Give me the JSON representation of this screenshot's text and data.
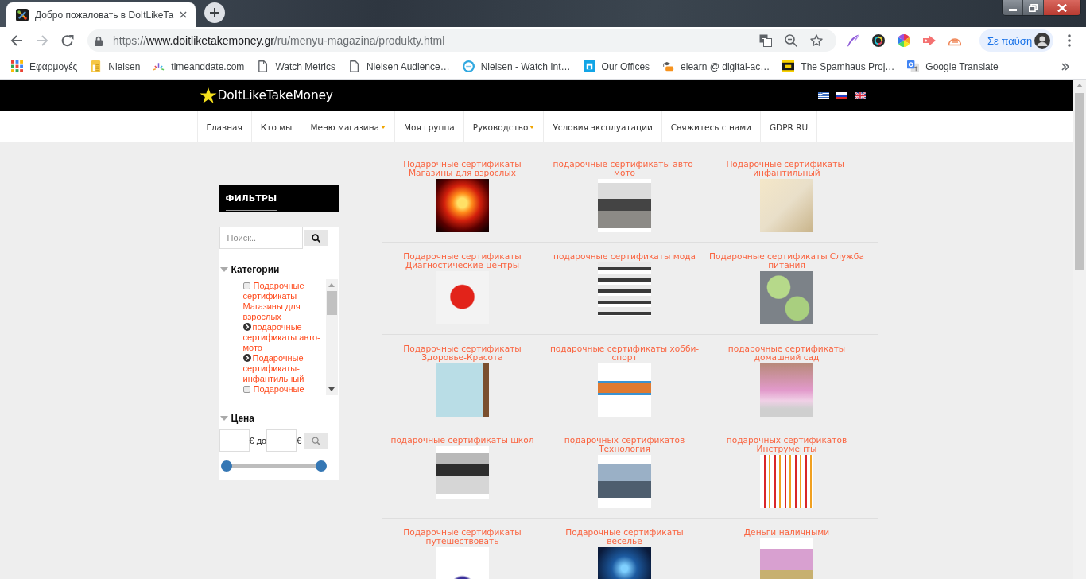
{
  "browser": {
    "tabs": [
      {
        "title": "Добро пожаловать в DoItLikeTa",
        "selected": true
      }
    ],
    "nav_buttons": [
      {
        "kind": "back",
        "disabled": false
      },
      {
        "kind": "forward",
        "disabled": true
      },
      {
        "kind": "reload",
        "disabled": false
      }
    ],
    "address": {
      "scheme": "https://",
      "host": "www.doitliketakemoney.gr",
      "path": "/ru/menyu-magazina/produkty.html"
    },
    "profile": {
      "label": "Σε παύση"
    },
    "bookmarks": [
      {
        "label": "Εφαρμογές"
      },
      {
        "label": "Nielsen"
      },
      {
        "label": "timeanddate.com"
      },
      {
        "label": "Watch Metrics"
      },
      {
        "label": "Nielsen Audience…"
      },
      {
        "label": "Nielsen - Watch Int…"
      },
      {
        "label": "Our Offices"
      },
      {
        "label": "elearn @ digital-ac…"
      },
      {
        "label": "The Spamhaus Proj…"
      },
      {
        "label": "Google Translate"
      }
    ]
  },
  "site": {
    "logo": "DoItLikeTakeMoney",
    "menu": [
      {
        "label": "Главная",
        "dropdown": false
      },
      {
        "label": "Кто мы",
        "dropdown": false
      },
      {
        "label": "Меню магазина",
        "dropdown": true
      },
      {
        "label": "Моя группа",
        "dropdown": false
      },
      {
        "label": "Руководство",
        "dropdown": true
      },
      {
        "label": "Условия эксплуатации",
        "dropdown": false
      },
      {
        "label": "Свяжитесь с нами",
        "dropdown": false
      },
      {
        "label": "GDPR RU",
        "dropdown": false
      }
    ]
  },
  "filters": {
    "title": "ФИЛЬТРЫ",
    "search": {
      "placeholder": "Поиск.."
    },
    "categories": {
      "title": "Категории",
      "expanded": true,
      "items": [
        {
          "kind": "checkbox",
          "label": "Подарочные сертификаты Магазины для взрослых",
          "checked": false
        },
        {
          "kind": "parent",
          "label": "подарочные сертификаты авто-мото",
          "expanded": false
        },
        {
          "kind": "parent",
          "label": "Подарочные сертификаты-инфантильный",
          "expanded": false
        },
        {
          "kind": "checkbox",
          "label": "Подарочные",
          "checked": false
        }
      ]
    },
    "price": {
      "title": "Цена",
      "expanded": true,
      "min_suffix": "€ до",
      "max_suffix": "€",
      "handles": [
        {
          "level": 0
        },
        {
          "level": 1
        }
      ]
    }
  },
  "products": {
    "rows": [
      {
        "divider_below": true,
        "items": [
          {
            "title": "Подарочные сертификаты Магазины для взрослых"
          },
          {
            "title": "подарочные сертификаты авто-мото"
          },
          {
            "title": "Подарочные сертификаты-инфантильный"
          }
        ]
      },
      {
        "divider_below": true,
        "items": [
          {
            "title": "Подарочные сертификаты Диагностические центры"
          },
          {
            "title": "подарочные сертификаты мода"
          },
          {
            "title": "Подарочные сертификаты Служба питания"
          }
        ]
      },
      {
        "divider_below": false,
        "items": [
          {
            "title": "Подарочные сертификаты Здоровье-Красота"
          },
          {
            "title": "подарочные сертификаты хобби-спорт"
          },
          {
            "title": "подарочные сертификаты домашний сад"
          }
        ]
      },
      {
        "divider_below": true,
        "items": [
          {
            "title": "подарочные сертификаты школ"
          },
          {
            "title": "подарочных сертификатов Технология"
          },
          {
            "title": "подарочных сертификатов Инструменты"
          }
        ]
      },
      {
        "divider_below": false,
        "items": [
          {
            "title": "Подарочные сертификаты путешествовать"
          },
          {
            "title": "Подарочные сертификаты веселье"
          },
          {
            "title": "Деньги наличными"
          }
        ]
      }
    ]
  }
}
